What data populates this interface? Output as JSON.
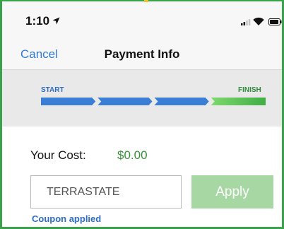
{
  "status_bar": {
    "time": "1:10",
    "icons": [
      "location-arrow-icon",
      "signal-icon",
      "wifi-icon",
      "battery-icon"
    ]
  },
  "nav": {
    "cancel_label": "Cancel",
    "title": "Payment Info"
  },
  "progress": {
    "start_label": "START",
    "finish_label": "FINISH",
    "steps_total": 4,
    "steps_completed": 3,
    "colors": {
      "completed": "#3a7fd5",
      "current": "#5fc85a"
    }
  },
  "cost": {
    "label": "Your Cost:",
    "value": "$0.00"
  },
  "coupon": {
    "value": "TERRASTATE",
    "apply_label": "Apply",
    "status": "Coupon applied"
  },
  "colors": {
    "accent_blue": "#2f7bd8",
    "accent_green": "#3b8f3b",
    "apply_disabled": "#a7d7a3"
  }
}
